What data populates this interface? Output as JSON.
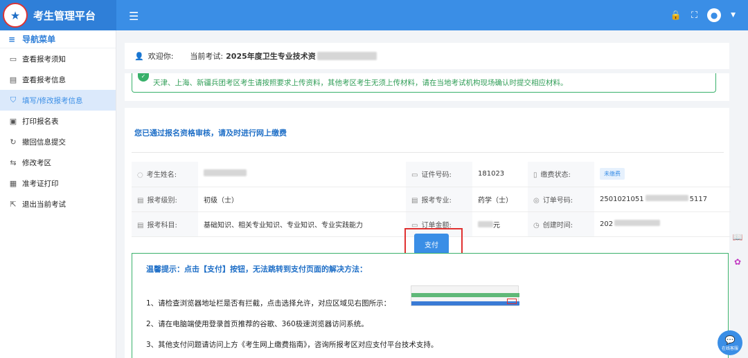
{
  "header": {
    "app_title": "考生管理平台",
    "menu_icon": "hamburger-icon",
    "icons": [
      "lock-icon",
      "fullscreen-icon",
      "user-avatar-icon",
      "chevron-down-icon"
    ]
  },
  "sidebar": {
    "title": "导航菜单",
    "items": [
      {
        "label": "查看报考须知",
        "icon": "message-icon",
        "active": false
      },
      {
        "label": "查看报考信息",
        "icon": "document-icon",
        "active": false
      },
      {
        "label": "填写/修改报考信息",
        "icon": "shield-check-icon",
        "active": true
      },
      {
        "label": "打印报名表",
        "icon": "print-icon",
        "active": false
      },
      {
        "label": "撤回信息提交",
        "icon": "undo-icon",
        "active": false
      },
      {
        "label": "修改考区",
        "icon": "switch-icon",
        "active": false
      },
      {
        "label": "准考证打印",
        "icon": "card-icon",
        "active": false
      },
      {
        "label": "退出当前考试",
        "icon": "exit-icon",
        "active": false
      }
    ]
  },
  "welcome": {
    "greeting": "欢迎你:",
    "current_exam_label": "当前考试:",
    "current_exam_value": "2025年度卫生专业技术资"
  },
  "notice": {
    "text": "天津、上海、新疆兵团考区考生请按照要求上传资料，其他考区考生无须上传材料，请在当地考试机构现场确认时提交相应材料。"
  },
  "card": {
    "title": "您已通过报名资格审核，请及时进行网上缴费",
    "rows": [
      [
        {
          "label": "考生姓名:",
          "icon": "user-icon",
          "value": ""
        },
        {
          "label": "证件号码:",
          "icon": "id-card-icon",
          "value": "181023"
        },
        {
          "label": "缴费状态:",
          "icon": "phone-icon",
          "value": "未缴费"
        }
      ],
      [
        {
          "label": "报考级别:",
          "icon": "document-icon",
          "value": "初级（士）"
        },
        {
          "label": "报考专业:",
          "icon": "document-icon",
          "value": "药学（士）"
        },
        {
          "label": "订单号码:",
          "icon": "target-icon",
          "value": "2501021051"
        }
      ],
      [
        {
          "label": "报考科目:",
          "icon": "document-icon",
          "value": "基础知识、相关专业知识、专业知识、专业实践能力"
        },
        {
          "label": "订单金额:",
          "icon": "wallet-icon",
          "value": ""
        },
        {
          "label": "创建时间:",
          "icon": "clock-icon",
          "value": "202"
        }
      ]
    ],
    "order_suffix": "5117",
    "amount_suffix": "元",
    "pay_button": "支付"
  },
  "tips": {
    "title": "温馨提示：点击【支付】按钮，无法跳转到支付页面的解决方法：",
    "lines": [
      "1、请检查浏览器地址栏是否有拦截，点击选择允许，对应区域见右图所示：",
      "2、请在电脑端使用登录首页推荐的谷歌、360极速浏览器访问系统。",
      "3、其他支付问题请访问上方《考生网上缴费指南》，咨询所报考区对应支付平台技术支持。"
    ]
  },
  "floating": {
    "icons": [
      "book-icon",
      "brain-icon"
    ],
    "chat_icon": "chat-icon",
    "chat_label": "在线客服"
  },
  "colors": {
    "primary": "#3a8ee6",
    "success": "#38b06a",
    "highlight": "#e03030"
  }
}
